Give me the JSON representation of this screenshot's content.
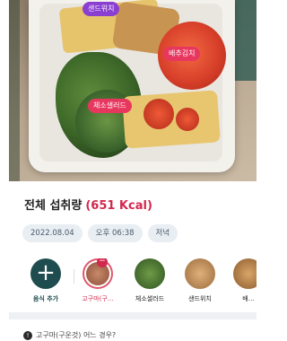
{
  "photo": {
    "tags": [
      {
        "label": "샌드위치",
        "color": "#8a3fd1"
      },
      {
        "label": "배추김치",
        "color": "#e8375f"
      },
      {
        "label": "체소샐러드",
        "color": "#e8375f"
      }
    ]
  },
  "summary": {
    "title": "전체 섭취량",
    "kcal": "(651 Kcal)"
  },
  "chips": {
    "date": "2022.08.04",
    "time": "오후 06:38",
    "meal": "저녁"
  },
  "foods": {
    "add_label": "음식 추가",
    "add_icon": "+",
    "items": [
      {
        "label": "고구마(구…",
        "selected": true,
        "icon": "sweet-potato"
      },
      {
        "label": "체소샐러드",
        "selected": false,
        "icon": "salad"
      },
      {
        "label": "샌드위치",
        "selected": false,
        "icon": "sandwich"
      },
      {
        "label": "배…",
        "selected": false,
        "icon": "kimchi"
      }
    ]
  },
  "notice": {
    "text": "고구마(구운것) 어느 경우?"
  },
  "colors": {
    "accent": "#d2284e",
    "add_button": "#1f4c4f",
    "chip_bg": "#e9eef3"
  }
}
